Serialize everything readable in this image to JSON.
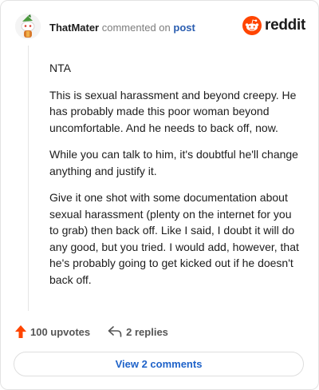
{
  "header": {
    "username": "ThatMater",
    "action_text": "commented on",
    "post_link": "post"
  },
  "brand": {
    "wordmark": "reddit",
    "color": "#ff4500"
  },
  "comment": {
    "paragraphs": [
      "NTA",
      "This is sexual harassment and beyond creepy. He has probably made this poor woman beyond uncomfortable. And he needs to back off, now.",
      "While you can talk to him, it's doubtful he'll change anything and justify it.",
      "Give it one shot with some documentation about sexual harassment (plenty on the internet for you to grab) then back off. Like I said, I doubt it will do any good, but you tried. I would add, however, that he's probably going to get kicked out if he doesn't back off."
    ]
  },
  "actions": {
    "upvotes_label": "100 upvotes",
    "replies_label": "2 replies",
    "upvote_color": "#ff4500"
  },
  "footer": {
    "view_comments_label": "View 2 comments"
  },
  "icons": {
    "upvote": "upvote-arrow-icon",
    "reply": "reply-arrow-icon",
    "logo": "reddit-alien-icon",
    "avatar": "snoo-avatar"
  }
}
